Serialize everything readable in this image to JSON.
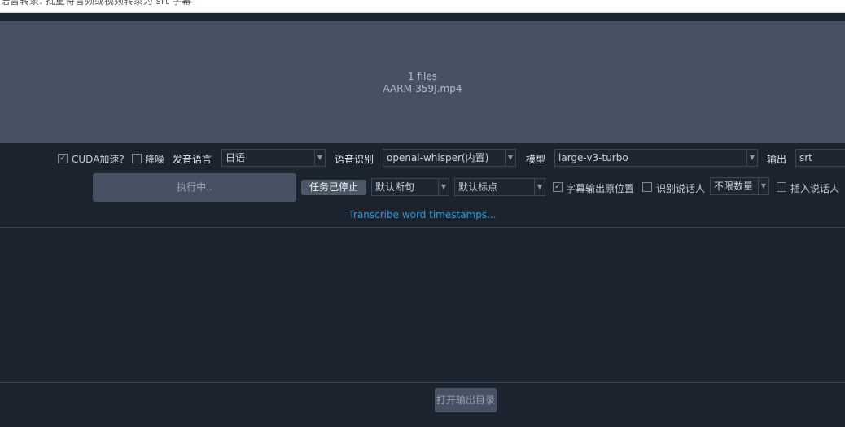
{
  "window": {
    "title": "语音转录: 批量将音频或视频转录为 srt 字幕"
  },
  "dropzone": {
    "count_text": "1 files",
    "file_name": "AARM-359J.mp4"
  },
  "options": {
    "cuda_label": "CUDA加速?",
    "cuda_checked": true,
    "denoise_label": "降噪",
    "denoise_checked": false,
    "language_label": "发音语言",
    "language_value": "日语",
    "recognition_label": "语音识别",
    "recognition_value": "openai-whisper(内置)",
    "model_label": "模型",
    "model_value": "large-v3-turbo",
    "output_label": "输出",
    "output_value": "srt"
  },
  "actions": {
    "run_label": "执行中..",
    "stop_label": "任务已停止",
    "sentence_split_value": "默认断句",
    "punctuation_value": "默认标点",
    "original_position_label": "字幕输出原位置",
    "original_position_checked": true,
    "speaker_id_label": "识别说话人",
    "speaker_id_checked": false,
    "speaker_limit_value": "不限数量",
    "insert_speaker_label": "插入说话人",
    "insert_speaker_checked": false
  },
  "link": {
    "label": "Transcribe word timestamps..."
  },
  "footer": {
    "open_output_label": "打开输出目录"
  },
  "colors": {
    "background": "#1a232e",
    "dropzone": "#465263",
    "link": "#2f95d8"
  }
}
